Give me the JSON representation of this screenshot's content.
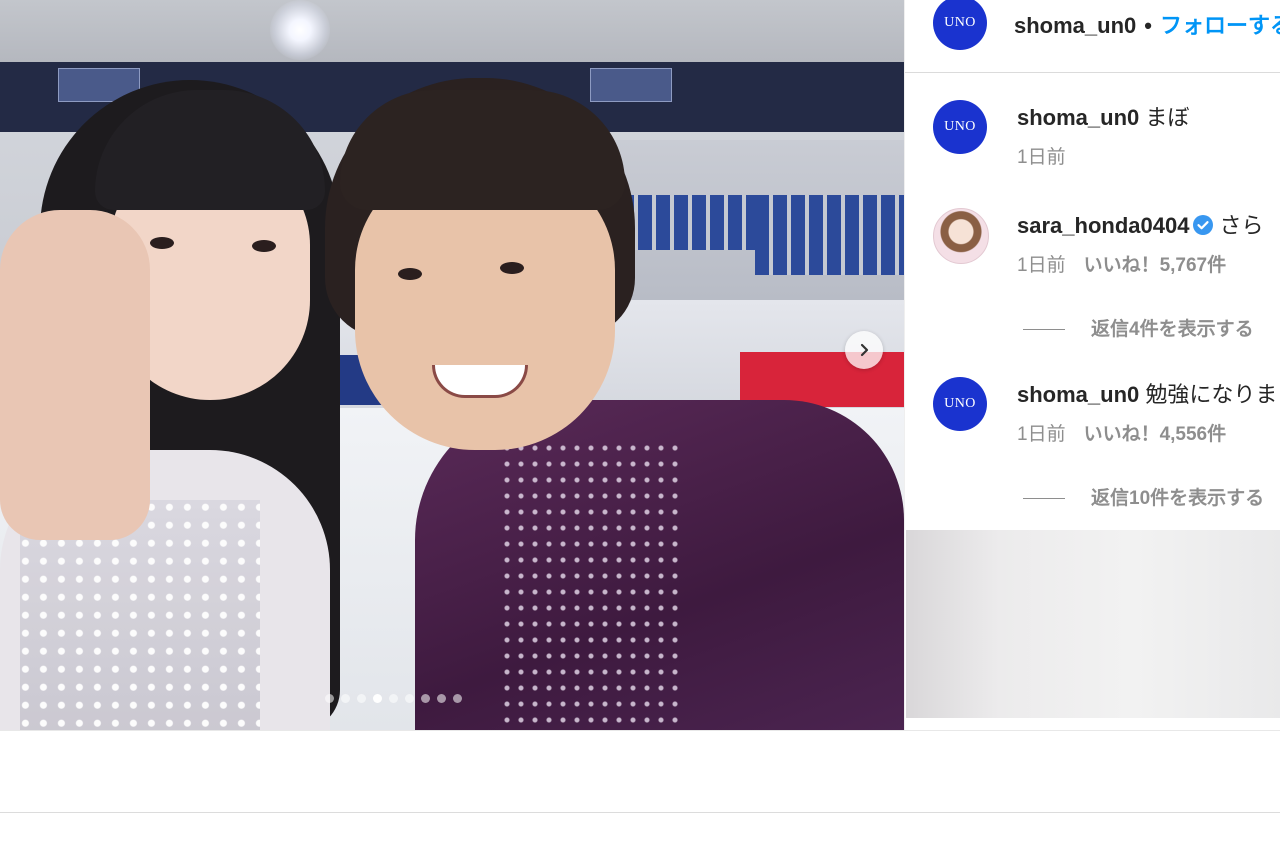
{
  "header": {
    "username": "shoma_un0",
    "separator": "•",
    "follow_label": "フォローする",
    "avatar_text": "UNO"
  },
  "carousel": {
    "slide_count": 9,
    "active_index": 3
  },
  "comments": [
    {
      "username": "shoma_un0",
      "avatar_text": "UNO",
      "text": "まぼ",
      "time": "1日前",
      "likes": "",
      "replies": ""
    },
    {
      "username": "sara_honda0404",
      "verified": true,
      "text": "さら",
      "time": "1日前",
      "likes": "いいね！5,767件",
      "replies": "返信4件を表示する"
    },
    {
      "username": "shoma_un0",
      "avatar_text": "UNO",
      "text": "勉強になりま",
      "time": "1日前",
      "likes": "いいね！4,556件",
      "replies": "返信10件を表示する"
    }
  ],
  "colors": {
    "follow": "#0095f6",
    "avatar_bg": "#1a33cf",
    "text": "#262626",
    "meta": "#8e8e8e"
  }
}
